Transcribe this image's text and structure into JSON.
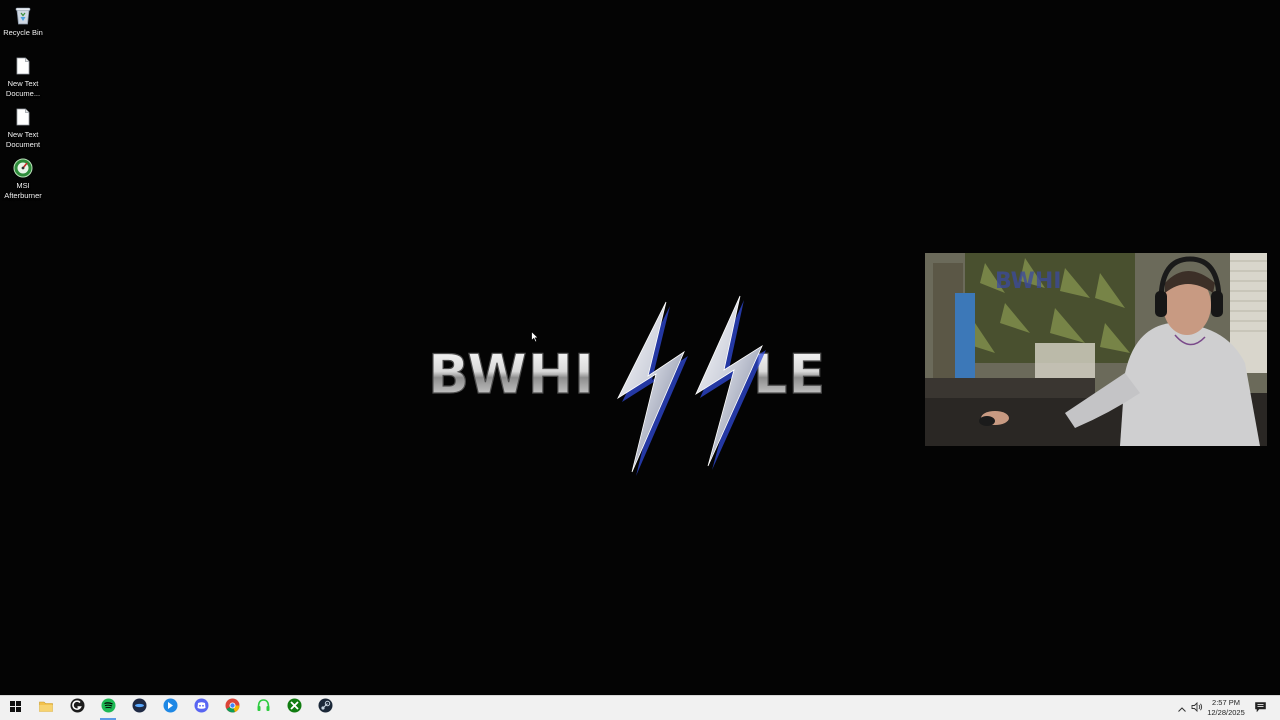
{
  "desktop": {
    "icons": [
      {
        "label": "Recycle Bin",
        "icon": "recycle-bin-icon"
      },
      {
        "label": "New Text\nDocume...",
        "icon": "text-file-icon"
      },
      {
        "label": "New Text\nDocument",
        "icon": "text-file-icon"
      },
      {
        "label": "MSI\nAfterburner",
        "icon": "msi-afterburner-icon"
      }
    ],
    "wallpaper_logo": "BWHISSLE",
    "background_color": "#040404"
  },
  "webcam": {
    "description_icon": "webcam-feed"
  },
  "taskbar": {
    "apps": [
      {
        "name": "start",
        "icon": "windows-start-icon"
      },
      {
        "name": "file-explorer",
        "icon": "folder-icon"
      },
      {
        "name": "logitech-g-hub",
        "icon": "logitech-g-icon"
      },
      {
        "name": "spotify",
        "icon": "spotify-icon"
      },
      {
        "name": "app-5",
        "icon": "blue-oval-icon"
      },
      {
        "name": "app-6",
        "icon": "blue-circle-app-icon"
      },
      {
        "name": "discord",
        "icon": "discord-icon"
      },
      {
        "name": "chrome",
        "icon": "chrome-icon"
      },
      {
        "name": "headset-app",
        "icon": "headset-icon"
      },
      {
        "name": "xbox",
        "icon": "xbox-icon"
      },
      {
        "name": "steam",
        "icon": "steam-icon"
      }
    ],
    "clock": {
      "time": "2:57 PM",
      "date": "12/28/2025"
    },
    "accent": "#5c9be6"
  }
}
